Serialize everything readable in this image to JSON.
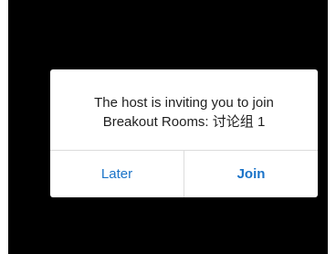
{
  "dialog": {
    "message_line1": "The host is inviting you to join",
    "message_line2": "Breakout Rooms: 讨论组 1",
    "later_label": "Later",
    "join_label": "Join"
  },
  "colors": {
    "background": "#000000",
    "dialog": "#ffffff",
    "accent": "#1a73c8",
    "text": "#1f1f1f"
  }
}
